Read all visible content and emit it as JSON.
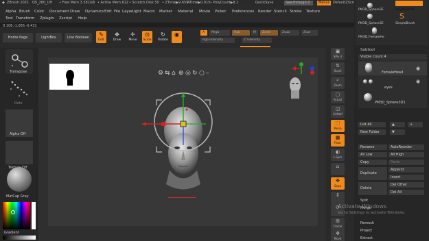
{
  "titlebar": {
    "app": "ZBrush 2021",
    "file": "QS_260_UH",
    "free_mem": "• Free Mem 3.381GB",
    "active_mem": "• Active Mem 612",
    "scratch": "• Scratch Disk 50",
    "ztime": "• ZTime▶9.659",
    "atime": "ATime▶0.015",
    "polycount": "• PolyCount▶8.1",
    "quicksave": "QuickSave",
    "see_through": "See-through 0",
    "menus_btn": "Menus",
    "default_script": "DefaultZScript"
  },
  "menubar": {
    "row1": [
      "Alpha",
      "Brush",
      "Color",
      "Document",
      "Draw",
      "Dynamics",
      "Edit",
      "File",
      "Layer",
      "Light",
      "Macro",
      "Marker",
      "Material",
      "Movie",
      "Picker",
      "Preferences",
      "Render",
      "Stencil",
      "Stroke",
      "Texture"
    ],
    "row2": [
      "Tool",
      "Transform",
      "Zplugin",
      "Zscript",
      "Help"
    ]
  },
  "coords": "0.108,-1.065,-0.431",
  "toolbar": {
    "home": "Home Page",
    "lightbox": "LightBox",
    "live_boolean": "Live Boolean",
    "tools": [
      {
        "label": "Edit",
        "glyph": "✎",
        "active": true
      },
      {
        "label": "Draw",
        "glyph": "✥",
        "active": false
      },
      {
        "label": "Move",
        "glyph": "✛",
        "active": false
      },
      {
        "label": "Scale",
        "glyph": "⊡",
        "active": true
      },
      {
        "label": "Rotate",
        "glyph": "↻",
        "active": false
      },
      {
        "label": "",
        "glyph": "◉",
        "active": true
      }
    ],
    "a_label": "A",
    "mrgb": "Mrgb",
    "rgb": "Rgb",
    "m": "M",
    "zadd": "Zadd",
    "zsub": "Zsub",
    "zcut": "Zcut",
    "rgb_intensity": "Rgb Intensity",
    "z_intensity": "Z Intensity"
  },
  "leftshelf": {
    "transpose": "Transpose",
    "dots": "Dots",
    "alpha_off": "Alpha Off",
    "texture_off": "Texture Off",
    "matcap": "MatCap Gray",
    "gradient": "Gradient"
  },
  "rightshelf": {
    "buttons": [
      {
        "label": "SPix 3",
        "glyph": "▣",
        "active": false
      },
      {
        "label": "Scroll",
        "glyph": "⇅",
        "active": false
      },
      {
        "label": "Zoom",
        "glyph": "⌕",
        "active": false
      },
      {
        "label": "Actual",
        "glyph": "▢",
        "active": false
      },
      {
        "label": "AAHalf",
        "glyph": "◫",
        "active": false
      },
      {
        "label": "Persp",
        "glyph": "⬚",
        "active": true
      },
      {
        "label": "Floor",
        "glyph": "▦",
        "active": true
      },
      {
        "label": "L.Sym",
        "glyph": "◐",
        "active": false
      },
      {
        "label": "",
        "glyph": "⌂",
        "active": false
      },
      {
        "label": "Qxyz",
        "glyph": "✥",
        "active": true
      },
      {
        "label": "",
        "glyph": "↕",
        "active": false
      },
      {
        "label": "",
        "glyph": "⟳",
        "active": false
      },
      {
        "label": "Frame",
        "glyph": "⊞",
        "active": false
      },
      {
        "label": "Move",
        "glyph": "✥",
        "active": false
      }
    ]
  },
  "tray": {
    "top_tools": [
      "PM3D_Sphere3E",
      "PolyMesh3D",
      "PM3D_Sphere3E",
      "SimpleBrush",
      "PM3D_FemaleHe"
    ],
    "subtool_title": "Subtool",
    "visible_count": "Visible Count 4",
    "subtools": [
      "FemaleHead",
      "eyes",
      "PM3D_Sphere3D1"
    ],
    "list_all": "List All",
    "new_folder": "New Folder",
    "rename": "Rename",
    "auto_reorder": "AutoReorder",
    "all_low": "All Low",
    "all_high": "All High",
    "copy": "Copy",
    "paste": "Paste",
    "append": "Append",
    "duplicate": "Duplicate",
    "insert": "Insert",
    "delete": "Delete",
    "del_other": "Del Other",
    "del_all": "Del All",
    "split": "Split",
    "merge": "Merge",
    "remesh": "Remesh",
    "project": "Project",
    "extract": "Extract"
  },
  "watermark": {
    "title": "Activate Windows",
    "subtitle": "Go to Settings to activate Windows."
  },
  "colors": {
    "accent": "#f08a1c",
    "axis_x": "#d42020",
    "axis_y": "#20b020",
    "axis_z": "#2040e0"
  }
}
